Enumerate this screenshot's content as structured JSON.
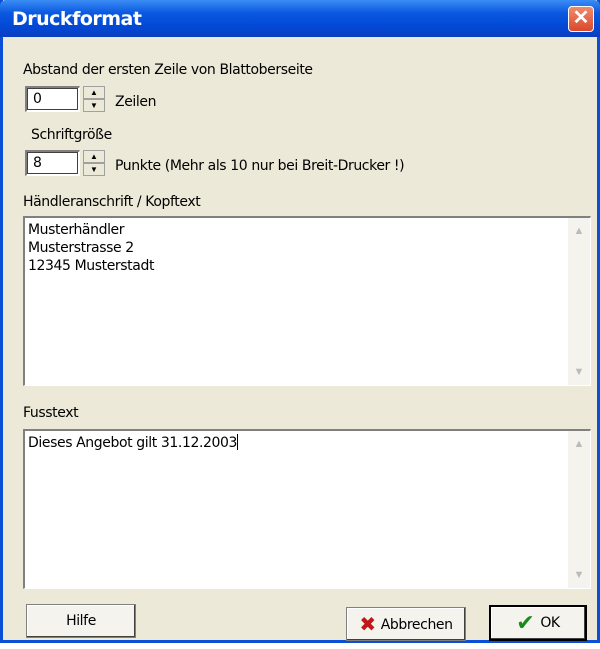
{
  "window": {
    "title": "Druckformat",
    "close_symbol": "✕"
  },
  "abstand": {
    "label": "Abstand der ersten Zeile von Blattoberseite",
    "value": "0",
    "unit": "Zeilen"
  },
  "schrift": {
    "label": "Schriftgröße",
    "value": "8",
    "unit": "Punkte  (Mehr als 10 nur bei Breit-Drucker !)"
  },
  "kopftext": {
    "label": "Händleranschrift / Kopftext",
    "text": "Musterhändler\nMusterstrasse 2\n12345 Musterstadt"
  },
  "fusstext": {
    "label": "Fusstext",
    "text": "Dieses Angebot gilt 31.12.2003"
  },
  "buttons": {
    "help": "Hilfe",
    "cancel": "Abbrechen",
    "ok": "OK"
  },
  "icons": {
    "cancel": "x-icon",
    "ok": "checkmark-icon",
    "close": "close-icon"
  },
  "colors": {
    "titlebar": "#0a58e0",
    "dialog_bg": "#ece9d8",
    "close_button": "#d9482a",
    "cancel_icon": "#c01818",
    "ok_icon": "#1a8a1a"
  }
}
